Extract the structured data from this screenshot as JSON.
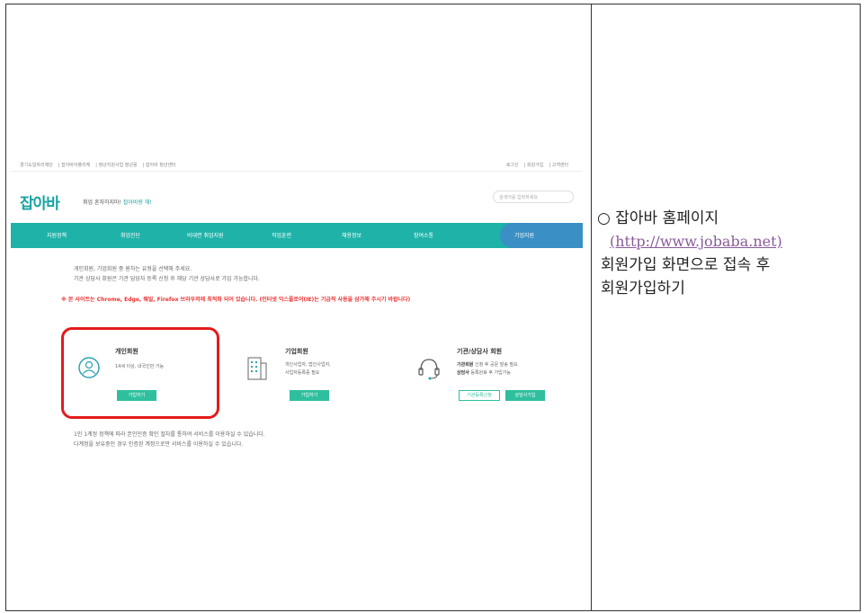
{
  "description": {
    "bullet": "○",
    "title": "잡아바 홈페이지",
    "url": "(http://www.jobaba.net)",
    "line1": "회원가입 화면으로 접속 후",
    "line2": "회원가입하기"
  },
  "screenshot": {
    "topbar_left": [
      "경기도일자리재단",
      "잡아바어플리케",
      "청년지원사업 청년몽",
      "잡아바 청년센터"
    ],
    "topbar_right": [
      "로그인",
      "회원가입",
      "고객센터"
    ],
    "logo": "잡아바",
    "tagline_prefix": "취업 혼자하지마!",
    "tagline_accent": "잡아바랑 해!",
    "search_placeholder": "검색어를 입력하세요",
    "nav": [
      "지원정책",
      "취업진단",
      "비대면 취업지원",
      "직업훈련",
      "채용정보",
      "참여소통",
      "기업지원"
    ],
    "intro_line1": "개인회원, 기업회원 중 원하는 유형을 선택해 주세요.",
    "intro_line2": "기관 상담사 회원은 기관 담당자 등록 신청 후 해당 기관 상담사로 가입 가능합니다.",
    "warning": "※ 본 사이트는 Chrome, Edge, 웨일, Firefox 브라우저에 최적화 되어 있습니다. (인터넷 익스플로어(IE)는 기급적 사용을 삼가해 주시기 바랍니다)",
    "personal": {
      "title": "개인회원",
      "text": "14세 이상, 내국인만 가능",
      "button": "가입하기"
    },
    "company": {
      "title": "기업회원",
      "text1": "개인사업자, 법인사업자,",
      "text2": "사업자등록증 필요",
      "button": "가입하기"
    },
    "agency": {
      "title": "기관/상담사 회원",
      "label1": "기관회원",
      "text1": "신청 후 공문 발송 필요",
      "label2": "상담사",
      "text2": "등록완료 후 가입가능",
      "button1": "기관등록신청",
      "button2": "상담사가입"
    },
    "note1": "1인 1계정 정책에 따라 본인인증 확인 절차를 통하여 서비스를 이용하실 수 있습니다.",
    "note2": "다계정을 보유중인 경우 인증된 계정으로만 서비스를 이용하실 수 있습니다."
  },
  "colors": {
    "nav": "#1fb2a8",
    "nav_active": "#3a8fc4",
    "highlight": "#e31b1b",
    "button": "#2fbf9f"
  }
}
